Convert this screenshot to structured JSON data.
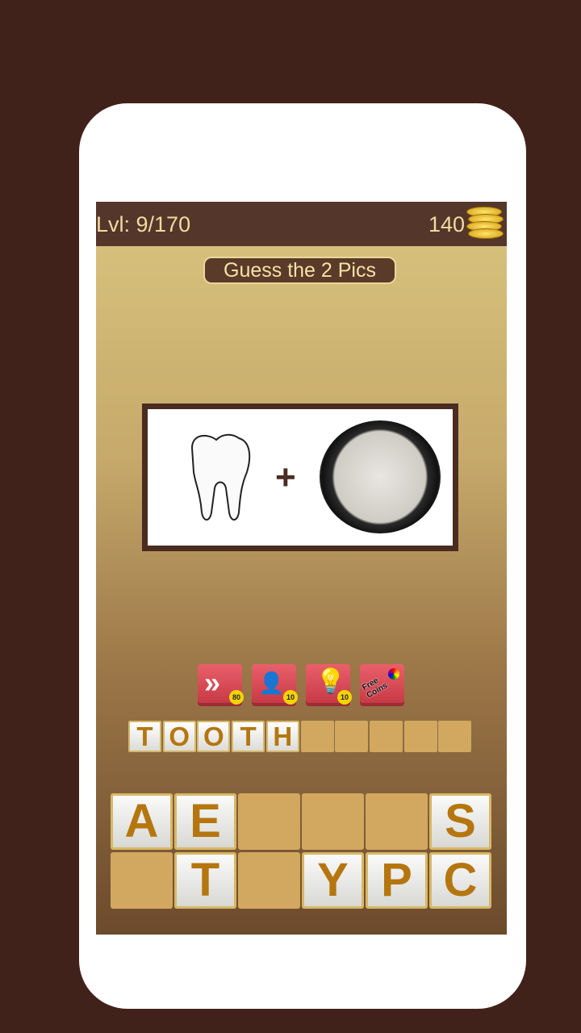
{
  "header": {
    "level": "Lvl: 9/170",
    "coins": "140"
  },
  "title": "Guess the 2 Pics",
  "puzzle": {
    "operator": "+",
    "images": [
      "tooth",
      "paste-jar"
    ]
  },
  "tools": [
    {
      "name": "skip",
      "icon": "double-chevron-icon",
      "cost": "80"
    },
    {
      "name": "ask-friend",
      "icon": "person-broadcast-icon",
      "cost": "10"
    },
    {
      "name": "hint",
      "icon": "lightbulb-icon",
      "cost": "10"
    },
    {
      "name": "free-coins",
      "icon": "color-wheel-icon",
      "label": "Free Coins"
    }
  ],
  "answer": [
    "T",
    "O",
    "O",
    "T",
    "H",
    "",
    "",
    "",
    "",
    ""
  ],
  "keyboard": [
    [
      "A",
      "E",
      "",
      "",
      "",
      "S"
    ],
    [
      "",
      "T",
      "",
      "Y",
      "P",
      "C"
    ]
  ]
}
